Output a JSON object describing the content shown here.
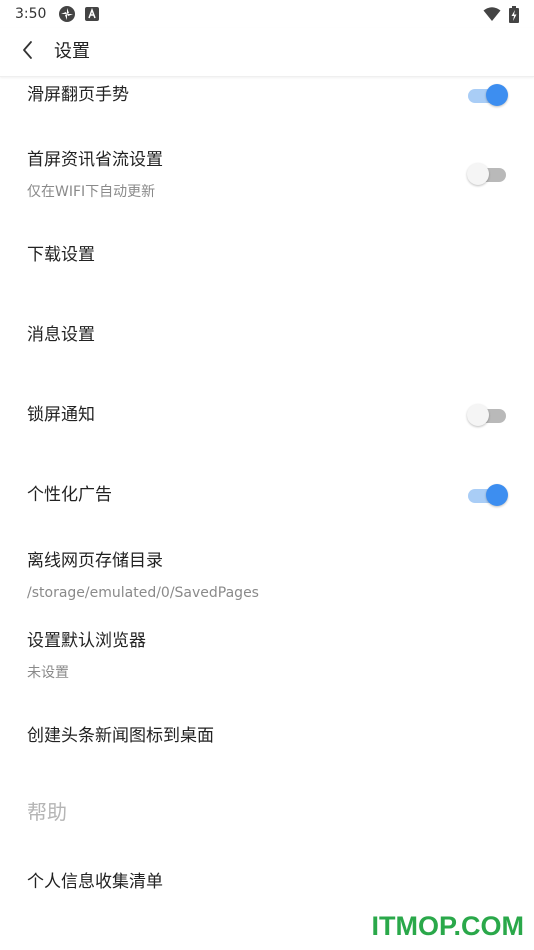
{
  "status_bar": {
    "time": "3:50",
    "icons": [
      "settings-notification-icon",
      "a-notification-icon",
      "wifi-icon",
      "battery-charging-icon"
    ]
  },
  "header": {
    "title": "设置",
    "back_icon": "chevron-left-icon"
  },
  "settings": [
    {
      "label": "滑屏翻页手势",
      "toggle": true
    },
    {
      "label": "首屏资讯省流设置",
      "subtitle": "仅在WIFI下自动更新",
      "toggle": false
    },
    {
      "label": "下载设置"
    },
    {
      "label": "消息设置"
    },
    {
      "label": "锁屏通知",
      "toggle": false
    },
    {
      "label": "个性化广告",
      "toggle": true
    },
    {
      "label": "离线网页存储目录",
      "subtitle": "/storage/emulated/0/SavedPages"
    },
    {
      "label": "设置默认浏览器",
      "subtitle": "未设置"
    },
    {
      "label": "创建头条新闻图标到桌面"
    }
  ],
  "help_section": {
    "title": "帮助",
    "items": [
      {
        "label": "个人信息收集清单"
      }
    ]
  },
  "watermark": "ITMOP.COM",
  "colors": {
    "toggle_on_thumb": "#3d8ef0",
    "toggle_on_track": "#a9cdf6",
    "toggle_off_thumb": "#f5f5f5",
    "toggle_off_track": "#b9b9b9",
    "watermark": "#2aa84a"
  }
}
